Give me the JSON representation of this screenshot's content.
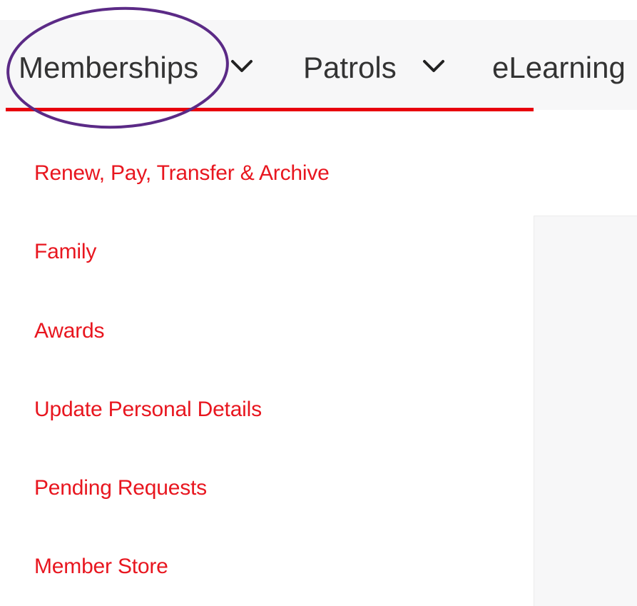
{
  "nav": {
    "items": [
      {
        "label": "Memberships"
      },
      {
        "label": "Patrols"
      },
      {
        "label": "eLearning"
      }
    ]
  },
  "dropdown": {
    "items": [
      {
        "label": "Renew, Pay, Transfer & Archive"
      },
      {
        "label": "Family"
      },
      {
        "label": "Awards"
      },
      {
        "label": "Update Personal Details"
      },
      {
        "label": "Pending Requests"
      },
      {
        "label": "Member Store"
      }
    ]
  },
  "icons": {
    "dropdown_chevron": "chevron-down-icon"
  },
  "colors": {
    "accent_red": "#e8000d",
    "link_red": "#e8161f",
    "annotation_purple": "#5b2a86",
    "nav_text": "#333333",
    "nav_background": "#f7f7f8"
  }
}
